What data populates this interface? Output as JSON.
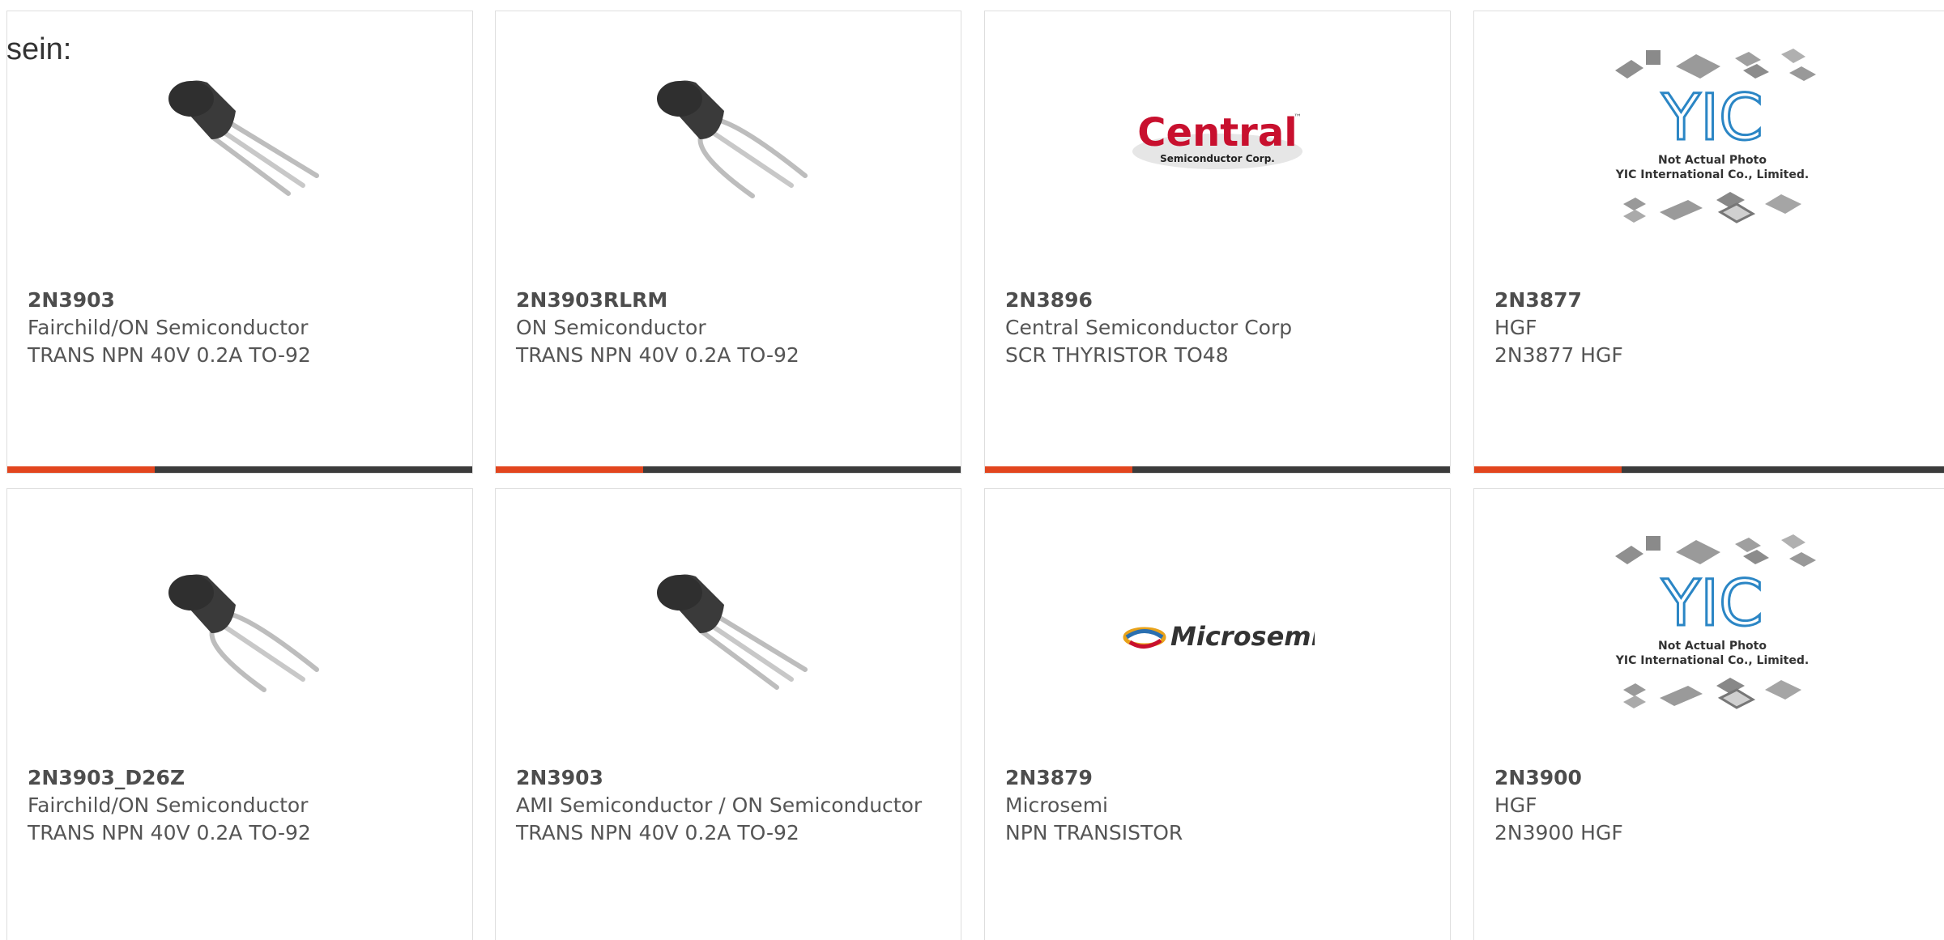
{
  "intro_text": "sein:",
  "colors": {
    "accent": "#e2451e",
    "bar": "#3b3b3b",
    "text": "#555555",
    "border": "#dedede"
  },
  "products": [
    {
      "part": "2N3903",
      "maker": "Fairchild/ON Semiconductor",
      "desc": "TRANS NPN 40V 0.2A TO-92",
      "image": "transistor-to92"
    },
    {
      "part": "2N3903RLRM",
      "maker": "ON Semiconductor",
      "desc": "TRANS NPN 40V 0.2A TO-92",
      "image": "transistor-to92-bent"
    },
    {
      "part": "2N3896",
      "maker": "Central Semiconductor Corp",
      "desc": "SCR THYRISTOR TO48",
      "image": "central-logo"
    },
    {
      "part": "2N3877",
      "maker": "HGF",
      "desc": "2N3877 HGF",
      "image": "yic-placeholder"
    },
    {
      "part": "2N3903_D26Z",
      "maker": "Fairchild/ON Semiconductor",
      "desc": "TRANS NPN 40V 0.2A TO-92",
      "image": "transistor-to92-bent"
    },
    {
      "part": "2N3903",
      "maker": "AMI Semiconductor / ON Semiconductor",
      "desc": "TRANS NPN 40V 0.2A TO-92",
      "image": "transistor-to92"
    },
    {
      "part": "2N3879",
      "maker": "Microsemi",
      "desc": "NPN TRANSISTOR",
      "image": "microsemi-logo"
    },
    {
      "part": "2N3900",
      "maker": "HGF",
      "desc": "2N3900 HGF",
      "image": "yic-placeholder"
    }
  ],
  "logos": {
    "central": {
      "name": "Central",
      "sub": "Semiconductor Corp.",
      "tm": "™"
    },
    "microsemi": {
      "name": "Microsemi"
    },
    "yic": {
      "mark": "YIC",
      "line1": "Not Actual Photo",
      "line2": "YIC International Co., Limited."
    }
  }
}
